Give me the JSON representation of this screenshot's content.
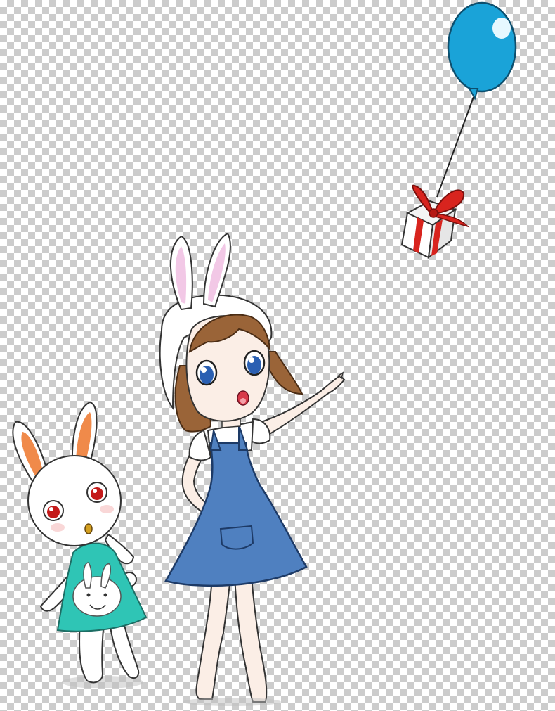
{
  "image": {
    "background": "transparency-checkerboard",
    "colors": {
      "checker_light": "#ffffff",
      "checker_dark": "#cccccc",
      "balloon": "#1aa3d8",
      "gift_ribbon": "#d8241e",
      "dress": "#4f80c0",
      "hair": "#9a6438",
      "bunny_ear_inner": "#f08a4a",
      "bunny_shirt": "#2fc5b5",
      "skin": "#fbeee6"
    },
    "subjects": [
      "balloon",
      "gift-box",
      "girl-with-bunny-hood",
      "white-bunny"
    ]
  }
}
